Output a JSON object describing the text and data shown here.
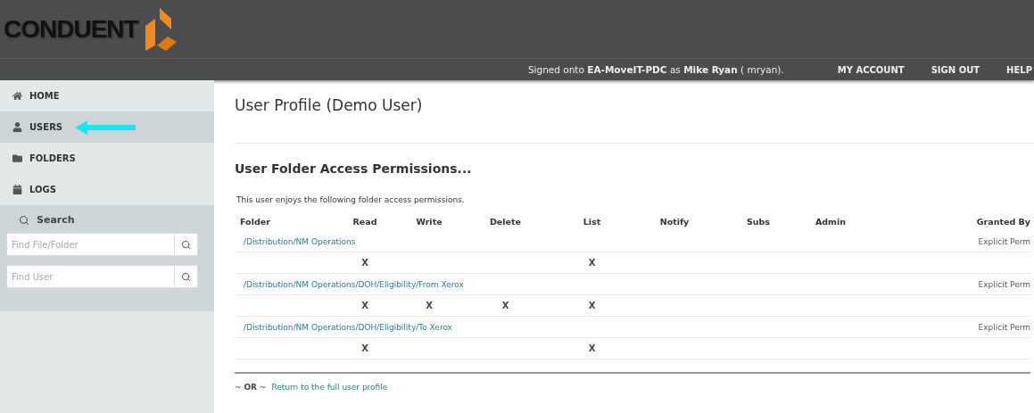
{
  "header": {
    "logo_text": "CONDUENT",
    "signed_on": "Signed onto **EA-MoveIT-PDC** as **Mike Ryan** ( mryan).",
    "links": [
      "MY ACCOUNT",
      "SIGN OUT",
      "HELP"
    ]
  },
  "sidebar": {
    "items": [
      {
        "label": "HOME",
        "selected": false
      },
      {
        "label": "USERS",
        "selected": true
      },
      {
        "label": "FOLDERS",
        "selected": false
      },
      {
        "label": "LOGS",
        "selected": false
      }
    ],
    "search_title": "Search",
    "search_fields": [
      {
        "placeholder": "Find File/Folder"
      },
      {
        "placeholder": "Find User"
      }
    ]
  },
  "page": {
    "title": "User Profile (Demo User)",
    "section_title": "User Folder Access Permissions...",
    "intro": "This user enjoys the following folder access permissions.",
    "table": {
      "columns": [
        "Folder",
        "Read",
        "Write",
        "Delete",
        "List",
        "Notify",
        "Subs",
        "Admin",
        "Granted By"
      ],
      "rows": [
        {
          "folder": "/Distribution/NM Operations",
          "granted_by": "Explicit Perm",
          "permissions": {
            "read": "X",
            "list": "X"
          }
        },
        {
          "folder": "/Distribution/NM Operations/DOH/Eligibility/From Xerox",
          "granted_by": "Explicit Perm",
          "permissions": {
            "read": "X",
            "write": "X",
            "delete": "X",
            "list": "X"
          }
        },
        {
          "folder": "/Distribution/NM Operations/DOH/Eligibility/To Xerox",
          "granted_by": "Explicit Perm",
          "permissions": {
            "read": "X",
            "list": "X"
          }
        }
      ]
    },
    "footer": {
      "or_text": "~ **OR** ~",
      "link": "Return to the full user profile"
    }
  }
}
